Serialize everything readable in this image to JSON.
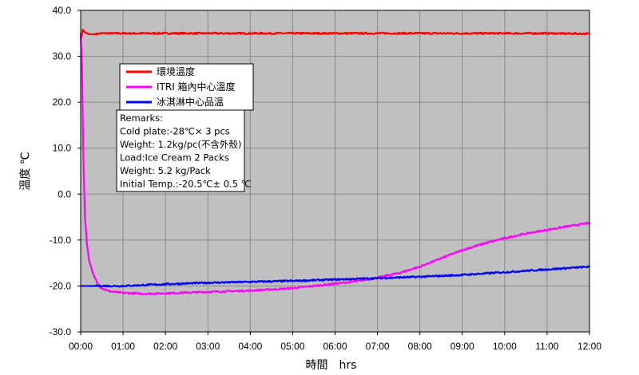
{
  "chart_data": {
    "type": "line",
    "title": "",
    "xlabel": "時間　hrs",
    "ylabel": "溫度 ℃",
    "x_ticks": [
      "00:00",
      "01:00",
      "02:00",
      "03:00",
      "04:00",
      "05:00",
      "06:00",
      "07:00",
      "08:00",
      "09:00",
      "10:00",
      "11:00",
      "12:00"
    ],
    "y_ticks": [
      "40.0",
      "30.0",
      "20.0",
      "10.0",
      "0.0",
      "-10.0",
      "-20.0",
      "-30.0"
    ],
    "xlim": [
      0,
      12
    ],
    "ylim": [
      -30,
      40
    ],
    "grid": true,
    "plot_background": "#c0c0c0",
    "legend_position": "upper-left",
    "series": [
      {
        "name": "環境溫度",
        "color": "#ff0000",
        "x": [
          0,
          0.05,
          0.1,
          0.2,
          0.3,
          0.5,
          1,
          2,
          3,
          4,
          5,
          6,
          7,
          8,
          9,
          10,
          11,
          12
        ],
        "y": [
          33.5,
          35.8,
          35.2,
          34.8,
          34.8,
          35.0,
          35.0,
          35.0,
          35.0,
          35.0,
          35.0,
          35.0,
          35.0,
          35.0,
          35.0,
          35.0,
          35.0,
          34.9
        ]
      },
      {
        "name": "ITRI 箱內中心溫度",
        "color": "#ff00ff",
        "x": [
          0,
          0.03,
          0.06,
          0.1,
          0.15,
          0.2,
          0.3,
          0.4,
          0.5,
          0.7,
          1,
          1.5,
          2,
          3,
          4,
          5,
          6,
          6.5,
          7,
          7.5,
          8,
          8.5,
          9,
          9.5,
          10,
          10.5,
          11,
          11.5,
          12
        ],
        "y": [
          35.0,
          28.0,
          10.0,
          -5.0,
          -11.0,
          -14.5,
          -17.5,
          -19.5,
          -20.5,
          -21.2,
          -21.5,
          -21.7,
          -21.6,
          -21.3,
          -21.0,
          -20.5,
          -19.5,
          -19.0,
          -18.2,
          -17.2,
          -15.8,
          -14.0,
          -12.2,
          -10.8,
          -9.6,
          -8.6,
          -7.8,
          -7.0,
          -6.3
        ]
      },
      {
        "name": "冰淇淋中心品溫",
        "color": "#0000ff",
        "x": [
          0,
          1,
          2,
          3,
          4,
          5,
          6,
          7,
          8,
          9,
          10,
          11,
          12
        ],
        "y": [
          -20.0,
          -20.0,
          -19.6,
          -19.3,
          -19.1,
          -18.9,
          -18.6,
          -18.3,
          -18.0,
          -17.6,
          -17.0,
          -16.4,
          -15.8
        ]
      }
    ],
    "remarks": [
      "Remarks:",
      "Cold plate:-28℃× 3 pcs",
      "Weight: 1.2kg/pc(不含外殼)",
      "Load:Ice Cream 2 Packs",
      "Weight: 5.2 kg/Pack",
      "Initial Temp.:-20.5℃± 0.5 ℃"
    ]
  }
}
